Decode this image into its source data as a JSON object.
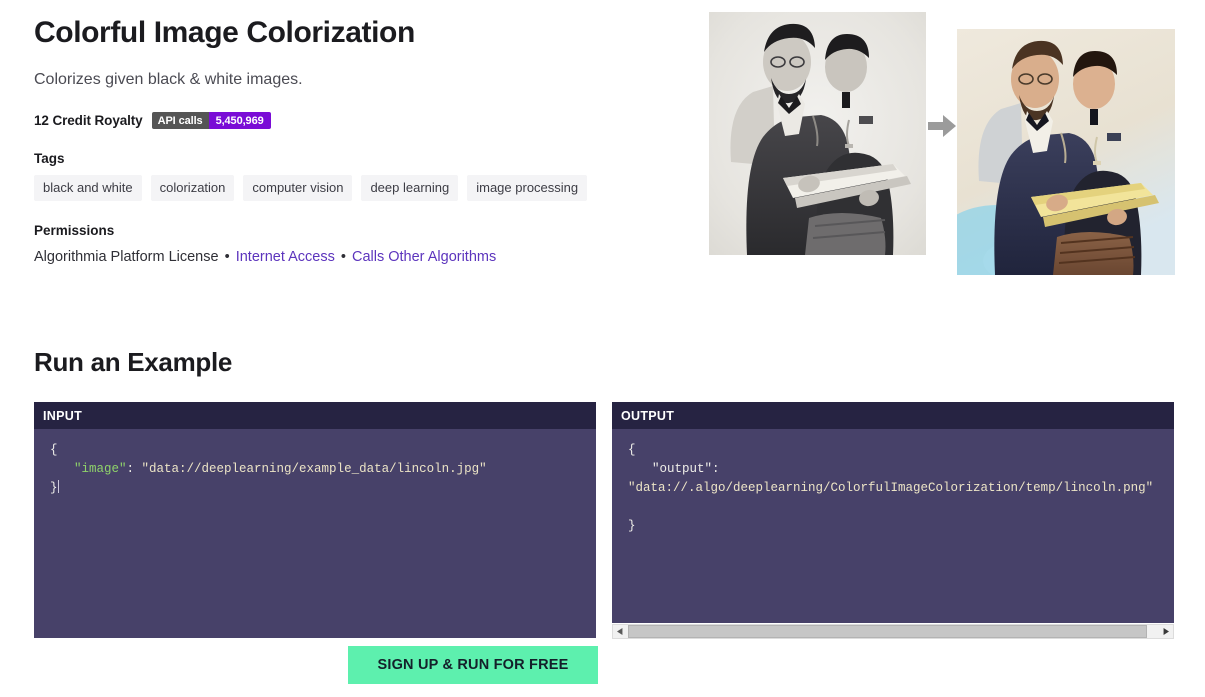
{
  "algorithm": {
    "title": "Colorful Image Colorization",
    "tagline": "Colorizes given black & white images.",
    "royalty": "12 Credit Royalty",
    "api_badge": {
      "label": "API calls",
      "value": "5,450,969",
      "label_color": "#555555",
      "value_color": "#7a0cd6"
    },
    "tags_label": "Tags",
    "tags": [
      "black and white",
      "colorization",
      "computer vision",
      "deep learning",
      "image processing"
    ],
    "permissions_label": "Permissions",
    "permissions": {
      "license": "Algorithmia Platform License",
      "separator": "•",
      "links": [
        "Internet Access",
        "Calls Other Algorithms"
      ],
      "link_color": "#5c34bd"
    }
  },
  "hero_images": {
    "before_alt": "black-and-white-photo-lincoln-reading-with-boy",
    "after_alt": "colorized-photo-lincoln-reading-with-boy",
    "arrow_icon": "arrow-right-icon"
  },
  "example": {
    "heading": "Run an Example",
    "input_panel": {
      "title": "INPUT",
      "lines": [
        {
          "indent": 0,
          "parts": [
            {
              "text": "{",
              "token": "plain"
            }
          ]
        },
        {
          "indent": 1,
          "parts": [
            {
              "text": "\"image\"",
              "token": "key"
            },
            {
              "text": ": ",
              "token": "plain"
            },
            {
              "text": "\"data://deeplearning/example_data/lincoln.jpg\"",
              "token": "string"
            }
          ]
        },
        {
          "indent": 0,
          "parts": [
            {
              "text": "}",
              "token": "plain"
            }
          ],
          "caret": true
        }
      ]
    },
    "output_panel": {
      "title": "OUTPUT",
      "lines": [
        {
          "indent": 0,
          "parts": [
            {
              "text": "{",
              "token": "plain"
            }
          ]
        },
        {
          "indent": 1,
          "parts": [
            {
              "text": "\"output\":",
              "token": "plain"
            }
          ]
        },
        {
          "indent": 0,
          "parts": [
            {
              "text": "\"data://.algo/deeplearning/ColorfulImageColorization/temp/lincoln.png\"",
              "token": "string"
            }
          ]
        },
        {
          "indent": 0,
          "parts": [
            {
              "text": "",
              "token": "plain"
            }
          ]
        },
        {
          "indent": 0,
          "parts": [
            {
              "text": "}",
              "token": "plain"
            }
          ]
        }
      ]
    },
    "scrollbar": {
      "left_arrow": "◀",
      "right_arrow": "▶"
    }
  },
  "cta": {
    "label": "SIGN UP & RUN FOR FREE",
    "background": "#5df0ae"
  },
  "colors": {
    "panel_header": "#262342",
    "panel_body": "#474169",
    "tag_chip": "#f4f4f6"
  }
}
